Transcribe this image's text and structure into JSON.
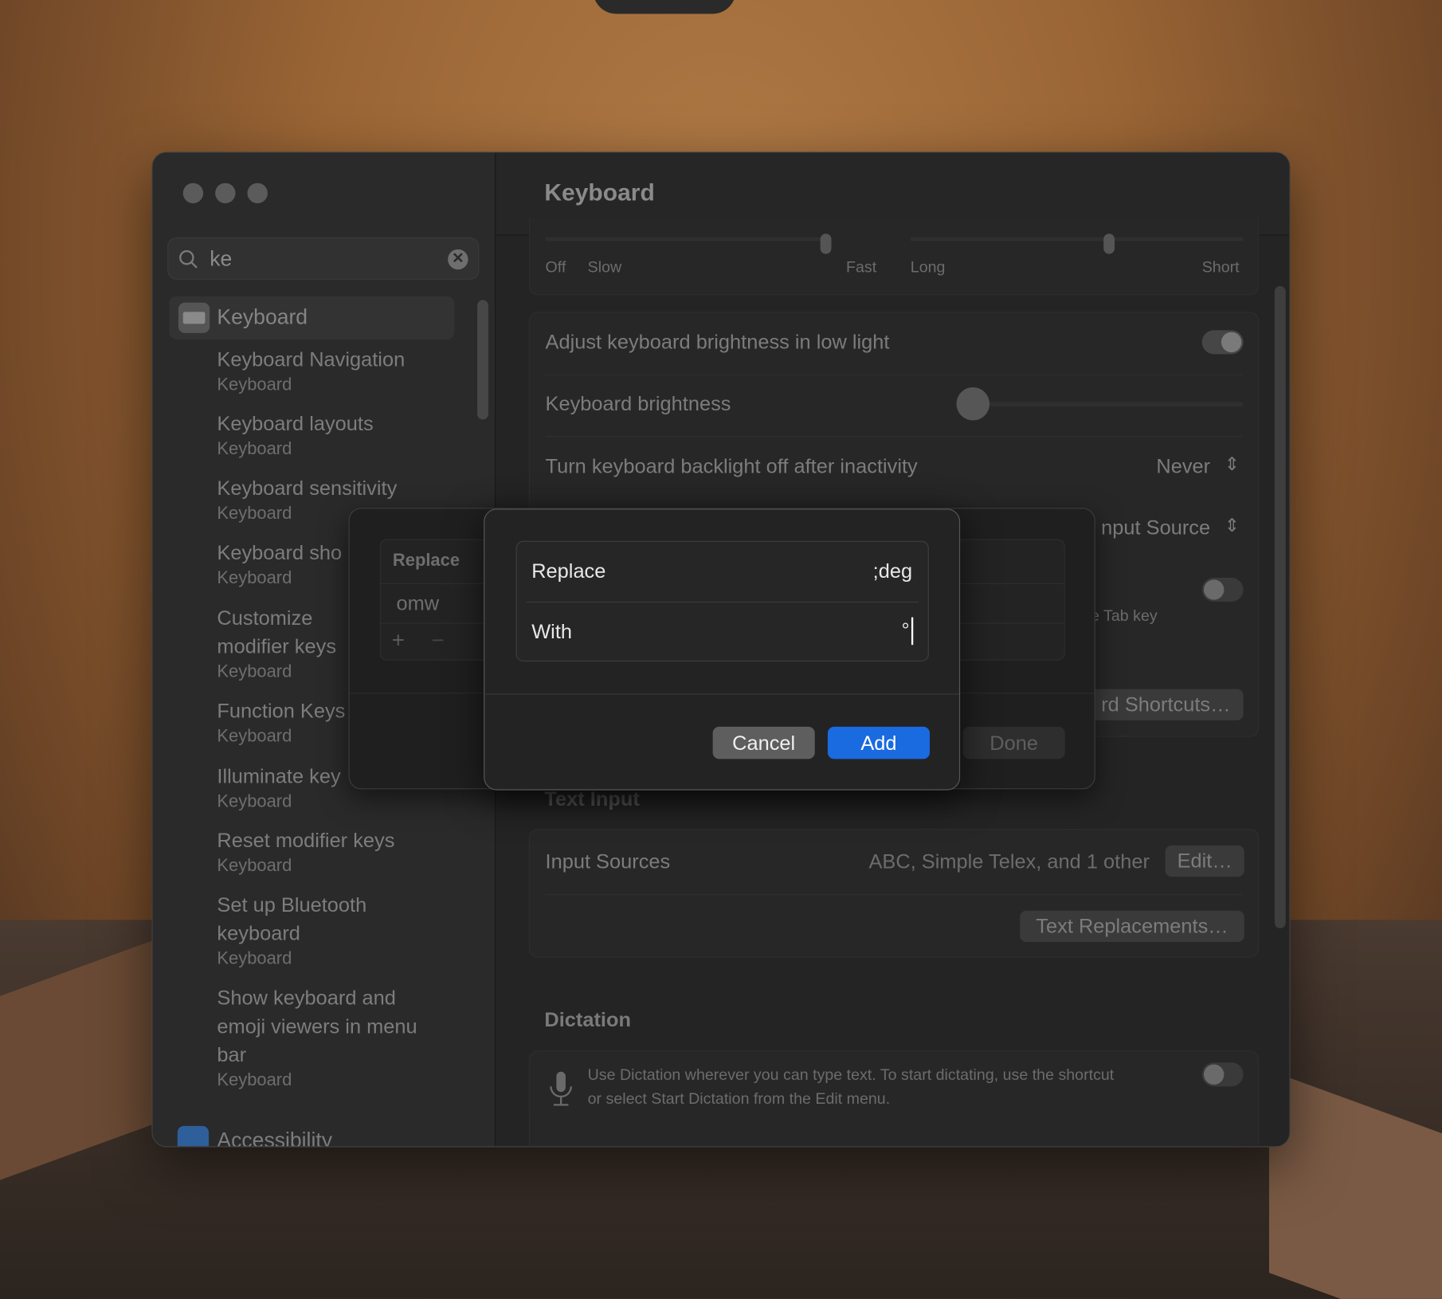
{
  "window": {
    "title": "Keyboard"
  },
  "sidebar": {
    "search": {
      "value": "ke"
    },
    "selected": {
      "label": "Keyboard"
    },
    "results": [
      {
        "title": "Keyboard Navigation",
        "sub": "Keyboard"
      },
      {
        "title": "Keyboard layouts",
        "sub": "Keyboard"
      },
      {
        "title": "Keyboard sensitivity",
        "sub": "Keyboard"
      },
      {
        "title": "Keyboard sho",
        "sub": "Keyboard"
      },
      {
        "title": "Customize modifier keys",
        "sub": "Keyboard"
      },
      {
        "title": "Function Keys",
        "sub": "Keyboard"
      },
      {
        "title": "Illuminate key",
        "sub": "Keyboard"
      },
      {
        "title": "Reset modifier keys",
        "sub": "Keyboard"
      },
      {
        "title": "Set up Bluetooth keyboard",
        "sub": "Keyboard"
      },
      {
        "title": "Show keyboard and emoji viewers in menu bar",
        "sub": "Keyboard"
      }
    ],
    "next_section": "Accessibility"
  },
  "main": {
    "key_repeat": {
      "labels": [
        "Off",
        "Slow",
        "Fast"
      ],
      "value_fraction": 0.88
    },
    "repeat_delay": {
      "labels": [
        "Long",
        "Short"
      ],
      "value_fraction": 0.6
    },
    "adjust_brightness": {
      "label": "Adjust keyboard brightness in low light",
      "on": true
    },
    "brightness": {
      "label": "Keyboard brightness",
      "value_fraction": 0.0
    },
    "backlight_off": {
      "label": "Turn keyboard backlight off after inactivity",
      "value": "Never"
    },
    "globe_key": {
      "value_partial": "nput Source"
    },
    "tab_nav": {
      "sub_partial": "e Tab key",
      "on": false
    },
    "shortcuts_button_partial": "rd Shortcuts…",
    "text_input": {
      "header": "Text Input",
      "input_sources_label": "Input Sources",
      "input_sources_value": "ABC, Simple Telex, and 1 other",
      "edit_button": "Edit…",
      "text_replacements_button": "Text Replacements…"
    },
    "dictation": {
      "header": "Dictation",
      "description_line1": "Use Dictation wherever you can type text. To start dictating, use the shortcut",
      "description_line2": "or select Start Dictation from the Edit menu.",
      "on": false
    }
  },
  "replacements_sheet": {
    "column_header": "Replace",
    "rows": [
      "omw"
    ],
    "add": "+",
    "remove": "−",
    "done_button": "Done"
  },
  "add_dialog": {
    "replace_label": "Replace",
    "replace_value": ";deg",
    "with_label": "With",
    "with_value": "°",
    "cancel_button": "Cancel",
    "add_button": "Add",
    "accent_color": "#1a6ae0"
  }
}
